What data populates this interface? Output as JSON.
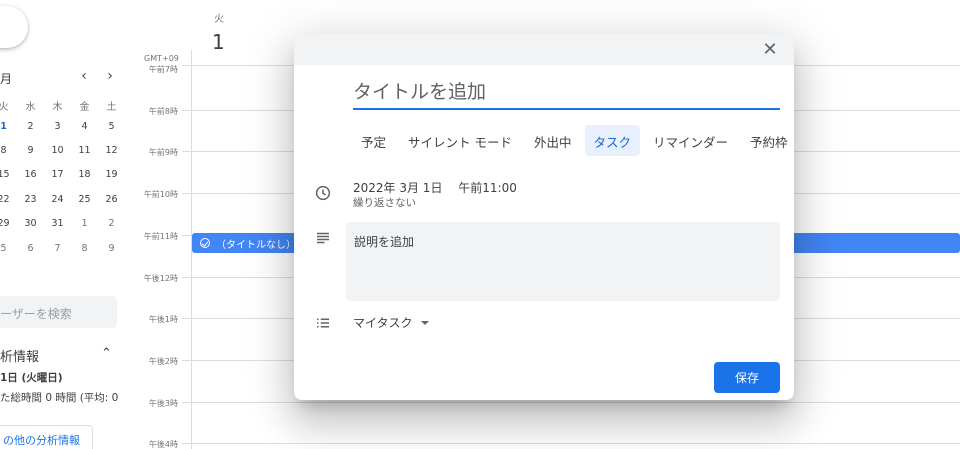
{
  "sidebar": {
    "mini_calendar": {
      "title": "月",
      "prev_icon": "chevron-left-icon",
      "next_icon": "chevron-right-icon",
      "dow": [
        "火",
        "水",
        "木",
        "金",
        "土"
      ],
      "weeks": [
        [
          {
            "d": "1",
            "m": false,
            "sel": true
          },
          {
            "d": "2",
            "m": false
          },
          {
            "d": "3",
            "m": false
          },
          {
            "d": "4",
            "m": false
          },
          {
            "d": "5",
            "m": false
          }
        ],
        [
          {
            "d": "8",
            "m": false
          },
          {
            "d": "9",
            "m": false
          },
          {
            "d": "10",
            "m": false
          },
          {
            "d": "11",
            "m": false
          },
          {
            "d": "12",
            "m": false
          }
        ],
        [
          {
            "d": "15",
            "m": false
          },
          {
            "d": "16",
            "m": false
          },
          {
            "d": "17",
            "m": false
          },
          {
            "d": "18",
            "m": false
          },
          {
            "d": "19",
            "m": false
          }
        ],
        [
          {
            "d": "22",
            "m": false
          },
          {
            "d": "23",
            "m": false
          },
          {
            "d": "24",
            "m": false
          },
          {
            "d": "25",
            "m": false
          },
          {
            "d": "26",
            "m": false
          }
        ],
        [
          {
            "d": "29",
            "m": false
          },
          {
            "d": "30",
            "m": false
          },
          {
            "d": "31",
            "m": false
          },
          {
            "d": "1",
            "m": true
          },
          {
            "d": "2",
            "m": true
          }
        ],
        [
          {
            "d": "5",
            "m": true
          },
          {
            "d": "6",
            "m": true
          },
          {
            "d": "7",
            "m": true
          },
          {
            "d": "8",
            "m": true
          },
          {
            "d": "9",
            "m": true
          }
        ]
      ]
    },
    "user_search_placeholder": "ーザーを検索",
    "insights": {
      "heading": "析情報",
      "toggle_icon": "chevron-up-icon",
      "date": "1日 (火曜日)",
      "total": "た総時間 0 時間 (平均: 0",
      "more_label": "の他の分析情報"
    }
  },
  "grid": {
    "day_of_week": "火",
    "day_number": "1",
    "timezone": "GMT+09",
    "hours": [
      "午前7時",
      "午前8時",
      "午前9時",
      "午前10時",
      "午前11時",
      "午後12時",
      "午後1時",
      "午後2時",
      "午後3時",
      "午後4時"
    ],
    "event": {
      "icon": "task-check-icon",
      "label": "（タイトルなし）"
    }
  },
  "dialog": {
    "close_icon": "close-icon",
    "title_placeholder": "タイトルを追加",
    "tabs": [
      {
        "label": "予定",
        "active": false
      },
      {
        "label": "サイレント モード",
        "active": false
      },
      {
        "label": "外出中",
        "active": false
      },
      {
        "label": "タスク",
        "active": true
      },
      {
        "label": "リマインダー",
        "active": false
      },
      {
        "label": "予約枠",
        "active": false
      }
    ],
    "datetime": {
      "icon": "clock-icon",
      "text": "2022年 3月 1日　 午前11:00",
      "repeat": "繰り返さない"
    },
    "description": {
      "icon": "notes-icon",
      "placeholder": "説明を追加"
    },
    "tasklist": {
      "icon": "list-icon",
      "value": "マイタスク"
    },
    "save_label": "保存"
  },
  "colors": {
    "accent": "#1a73e8",
    "event": "#4285f4",
    "tab_active_bg": "#e8f0fe"
  }
}
